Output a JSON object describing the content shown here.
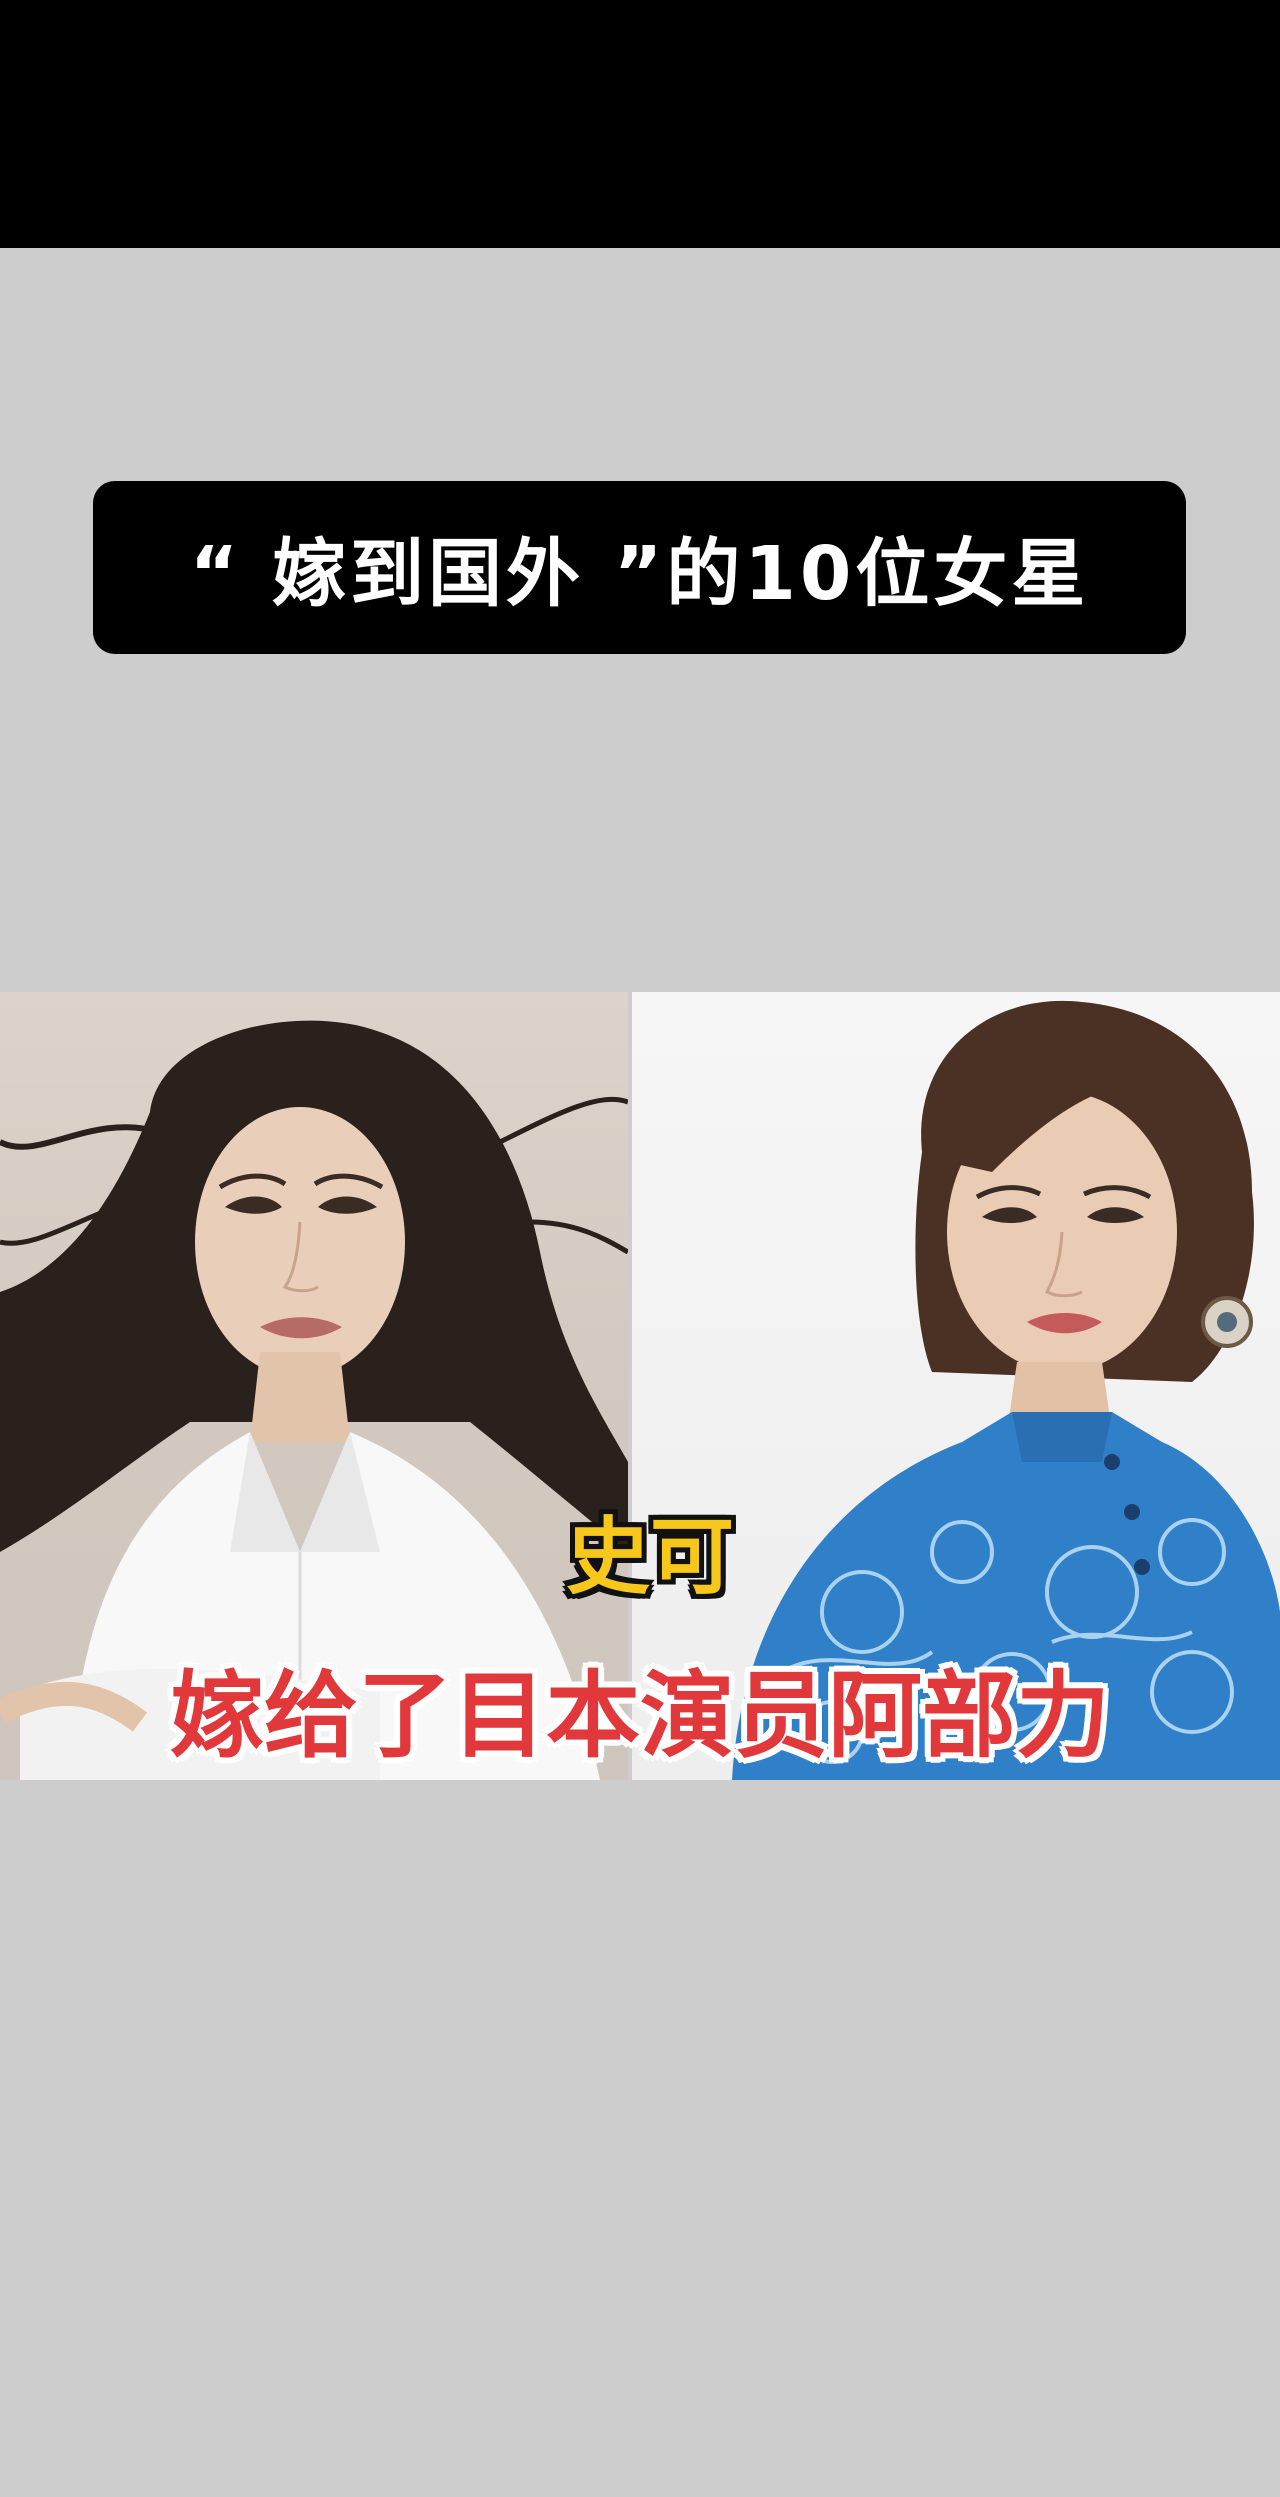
{
  "title": "“ 嫁到国外 ”的10位女星",
  "caption": {
    "name": "史可",
    "description": "嫁给了目本演员阿部力"
  },
  "colors": {
    "background": "#cdcdcd",
    "top_bar": "#000000",
    "title_pill": "#000000",
    "title_text": "#ffffff",
    "name_text": "#f7c71c",
    "description_text": "#e0383b"
  },
  "photos": {
    "left": "portrait-photo-white-shirt",
    "right": "portrait-photo-blue-qipao"
  }
}
